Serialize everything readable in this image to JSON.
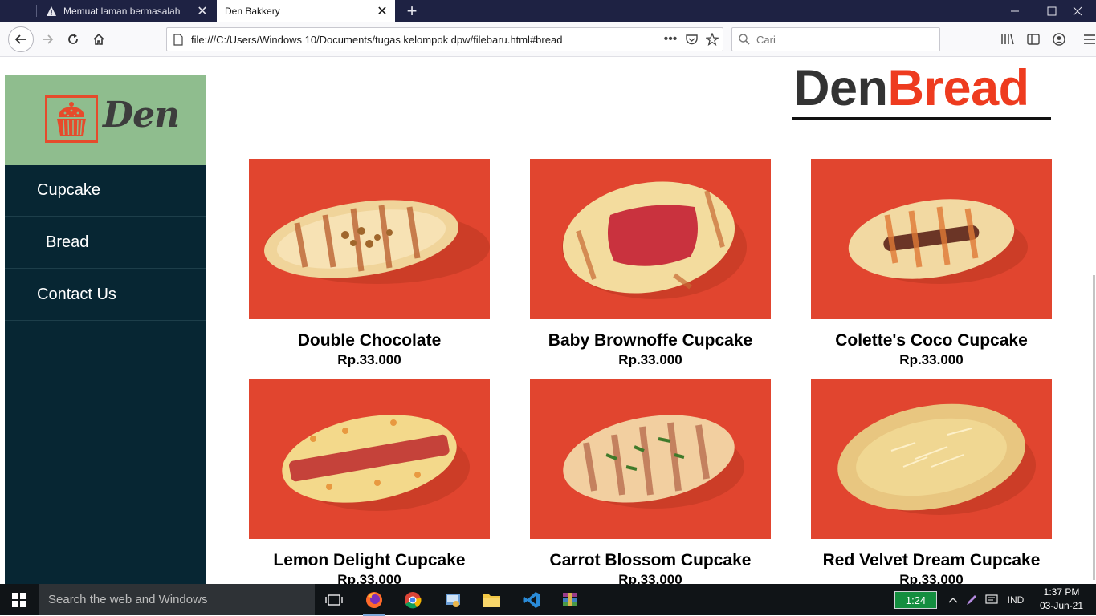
{
  "browser": {
    "tabs": [
      {
        "title": "Memuat laman bermasalah",
        "icon": "warning-icon"
      },
      {
        "title": "Den Bakkery",
        "active": true
      }
    ],
    "url": "file:///C:/Users/Windows 10/Documents/tugas kelompok dpw/filebaru.html#bread",
    "search_placeholder": "Cari"
  },
  "page": {
    "logo_text": "Den",
    "brand": {
      "part1": "Den",
      "part2": "Bread"
    },
    "menu": [
      {
        "label": "Cupcake"
      },
      {
        "label": "Bread"
      },
      {
        "label": "Contact Us"
      }
    ],
    "products": [
      {
        "name": "Double Chocolate",
        "price": "Rp.33.000"
      },
      {
        "name": "Baby Brownoffe Cupcake",
        "price": "Rp.33.000"
      },
      {
        "name": "Colette's Coco Cupcake",
        "price": "Rp.33.000"
      },
      {
        "name": "Lemon Delight Cupcake",
        "price": "Rp.33.000"
      },
      {
        "name": "Carrot Blossom Cupcake",
        "price": "Rp.33.000"
      },
      {
        "name": "Red Velvet Dream Cupcake",
        "price": "Rp.33.000"
      }
    ],
    "colors": {
      "sidebar": "#072633",
      "logo_bg": "#8fbd8e",
      "accent": "#ee3b1f",
      "product_bg": "#e1452f"
    }
  },
  "taskbar": {
    "search_text": "Search the web and Windows",
    "battery": "1:24",
    "language": "IND",
    "time": "1:37 PM",
    "date": "03-Jun-21"
  }
}
